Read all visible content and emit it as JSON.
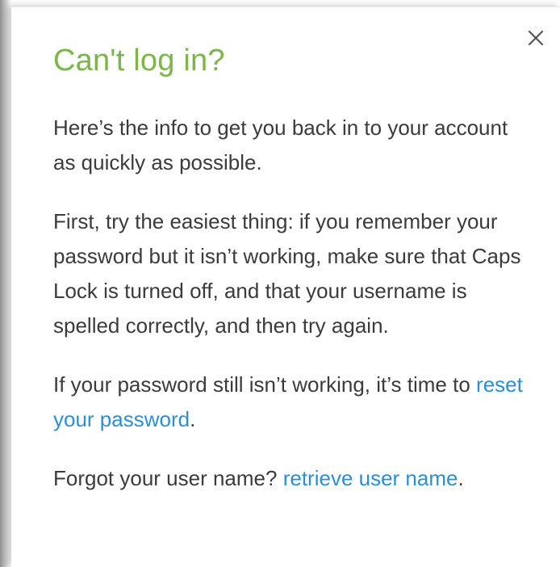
{
  "dialog": {
    "title": "Can't log in?",
    "close_icon": "close-icon",
    "paragraphs": {
      "intro": "Here’s the info to get you back in to your account as quickly as possible.",
      "first_try": "First, try the easiest thing: if you remember your password but it isn’t working, make sure that Caps Lock is turned off, and that your username is spelled correctly, and then try again.",
      "reset_prefix": "If your password still isn’t working, it’s time to ",
      "reset_link": "reset your password",
      "reset_suffix": ".",
      "forgot_prefix": "Forgot your user name? ",
      "retrieve_link": "retrieve user name",
      "forgot_suffix": "."
    }
  },
  "colors": {
    "title": "#7ab648",
    "body_text": "#3b3b3b",
    "link": "#2b8fd8",
    "close_icon": "#555555"
  }
}
